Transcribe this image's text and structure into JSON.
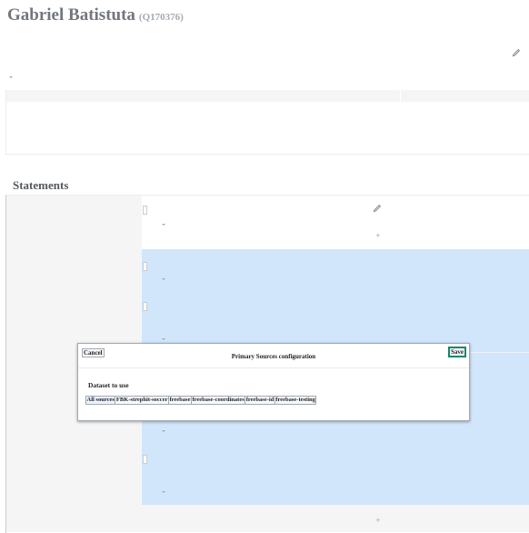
{
  "entity": {
    "label": "Gabriel Batistuta",
    "qid": "(Q170376)"
  },
  "statements": {
    "heading": "Statements"
  },
  "dialog": {
    "title": "Primary Sources configuration",
    "cancel_label": "Cancel",
    "save_label": "Save",
    "dataset_label": "Dataset to use",
    "dataset_options": [
      "All sources",
      "FBK-strephit-soccer",
      "freebase",
      "freebase-coordinates",
      "freebase-id",
      "freebase-testing"
    ],
    "selected_option": "All sources"
  },
  "icons": {
    "edit": "pencil-icon",
    "expand": "chevron-down-icon",
    "add": "plus-icon",
    "rank": "rank-selector-icon"
  },
  "colors": {
    "statement_highlight": "#d1e6fb",
    "title_grey": "#72777d",
    "save_border": "#14866d"
  }
}
